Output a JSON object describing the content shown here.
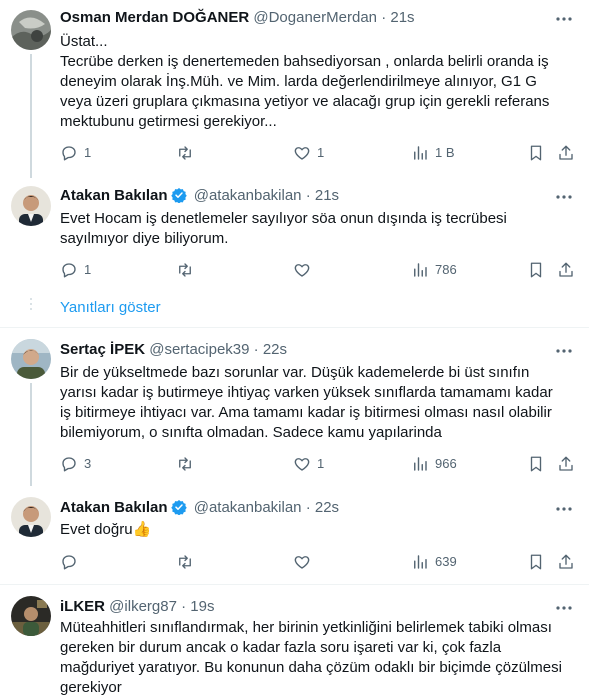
{
  "tweets": [
    {
      "name": "Osman Merdan DOĞANER",
      "handle": "@DoganerMerdan",
      "time": "21s",
      "verified": false,
      "lines": [
        "Üstat...",
        "Tecrübe derken iş denertemeden bahsediyorsan , onlarda belirli oranda iş",
        "deneyim olarak İnş.Müh. ve Mim. larda değerlendirilmeye alınıyor, G1  G",
        "veya üzeri gruplara çıkmasına yetiyor ve alacağı grup için gerekli referans",
        "mektubunu getirmesi gerekiyor..."
      ],
      "replies": "1",
      "retweets": "",
      "likes": "1",
      "views": "1 B"
    },
    {
      "name": "Atakan Bakılan",
      "handle": "@atakanbakilan",
      "time": "21s",
      "verified": true,
      "lines": [
        "Evet Hocam iş denetlemeler sayılıyor söa onun dışında iş tecrübesi",
        "sayılmıyor diye biliyorum."
      ],
      "replies": "1",
      "retweets": "",
      "likes": "",
      "views": "786"
    },
    {
      "name": "Sertaç İPEK",
      "handle": "@sertacipek39",
      "time": "22s",
      "verified": false,
      "lines": [
        "Bir de yükseltmede bazı sorunlar var. Düşük kademelerde bi üst sınıfın",
        "yarısı kadar iş butirmeye ihtiyaç varken yüksek sınıflarda tamamamı kadar",
        "iş bitirmeye ihtiyacı var. Ama tamamı kadar iş bitirmesi olması nasıl olabilir",
        "bilemiyorum, o sınıfta olmadan. Sadece kamu yapılarinda"
      ],
      "replies": "3",
      "retweets": "",
      "likes": "1",
      "views": "966"
    },
    {
      "name": "Atakan Bakılan",
      "handle": "@atakanbakilan",
      "time": "22s",
      "verified": true,
      "lines": [
        "Evet doğru👍"
      ],
      "replies": "",
      "retweets": "",
      "likes": "",
      "views": "639"
    },
    {
      "name": "iLKER",
      "handle": "@ilkerg87",
      "time": "19s",
      "verified": false,
      "lines": [
        "Müteahhitleri sınıflandırmak, her birinin yetkinliğini belirlemek tabiki olması",
        "gereken bir durum ancak o kadar fazla soru işareti var ki, çok fazla",
        "mağduriyet yaratıyor. Bu konunun daha çözüm odaklı bir biçimde çözülmesi",
        "gerekiyor"
      ]
    }
  ],
  "show_replies_label": "Yanıtları göster",
  "separator": "·",
  "colors": {
    "accent": "#1d9bf0",
    "secondary_text": "#536471",
    "border": "#eff3f4"
  }
}
